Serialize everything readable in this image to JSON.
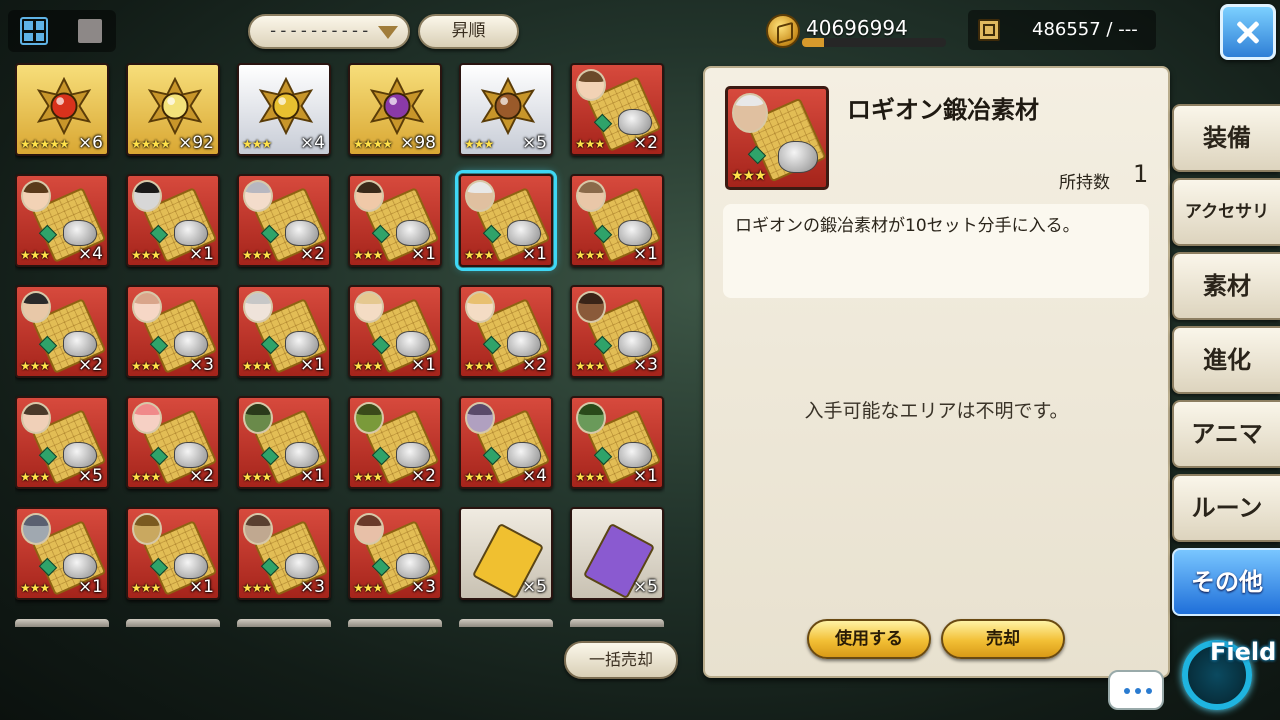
{
  "header": {
    "view_toggle": [
      "grid-view",
      "list-view"
    ],
    "filter_value": "----------",
    "sort_label": "昇順",
    "gold": "40696994",
    "gold_bar_fraction": 0.15,
    "materials": "486557 / ---"
  },
  "items": [
    {
      "type": "orb",
      "bg": "gold",
      "color": "#d9321c",
      "stars": "★★★★★",
      "qty": "×6"
    },
    {
      "type": "orb",
      "bg": "gold",
      "color": "#f3e27a",
      "stars": "★★★★",
      "qty": "×92"
    },
    {
      "type": "orb",
      "bg": "silver",
      "color": "#e8c030",
      "stars": "★★★",
      "qty": "×4"
    },
    {
      "type": "orb",
      "bg": "gold",
      "color": "#8a3aa8",
      "stars": "★★★★",
      "qty": "×98"
    },
    {
      "type": "orb",
      "bg": "silver",
      "color": "#9a5a2a",
      "stars": "★★★",
      "qty": "×5"
    },
    {
      "type": "scroll",
      "bg": "red",
      "face": "#f2d2b5",
      "hair": "#6b4a2a",
      "stars": "★★★",
      "qty": "×2"
    },
    {
      "type": "scroll",
      "bg": "red",
      "face": "#f2d2b5",
      "hair": "#5a3a1a",
      "stars": "★★★",
      "qty": "×4"
    },
    {
      "type": "scroll",
      "bg": "red",
      "face": "#d7d7d7",
      "hair": "#1a1a1a",
      "stars": "★★★",
      "qty": "×1"
    },
    {
      "type": "scroll",
      "bg": "red",
      "face": "#f3dccb",
      "hair": "#b7b7c0",
      "stars": "★★★",
      "qty": "×2"
    },
    {
      "type": "scroll",
      "bg": "red",
      "face": "#f0c9a8",
      "hair": "#3a2a1a",
      "stars": "★★★",
      "qty": "×1"
    },
    {
      "type": "scroll",
      "bg": "red",
      "face": "#e0c0a0",
      "hair": "#e8e8e8",
      "stars": "★★★",
      "qty": "×1",
      "selected": true
    },
    {
      "type": "scroll",
      "bg": "red",
      "face": "#e9c7a8",
      "hair": "#8a6a4a",
      "stars": "★★★",
      "qty": "×1"
    },
    {
      "type": "scroll",
      "bg": "red",
      "face": "#e8c8a8",
      "hair": "#2a2a2a",
      "stars": "★★★",
      "qty": "×2"
    },
    {
      "type": "scroll",
      "bg": "red",
      "face": "#f6d7c6",
      "hair": "#d9a58a",
      "stars": "★★★",
      "qty": "×3"
    },
    {
      "type": "scroll",
      "bg": "red",
      "face": "#efe3da",
      "hair": "#c7c7c7",
      "stars": "★★★",
      "qty": "×1"
    },
    {
      "type": "scroll",
      "bg": "red",
      "face": "#f4dcc4",
      "hair": "#e5c890",
      "stars": "★★★",
      "qty": "×1"
    },
    {
      "type": "scroll",
      "bg": "red",
      "face": "#f4dcc4",
      "hair": "#e8c070",
      "stars": "★★★",
      "qty": "×2"
    },
    {
      "type": "scroll",
      "bg": "red",
      "face": "#8a5a3a",
      "hair": "#3a2418",
      "stars": "★★★",
      "qty": "×3"
    },
    {
      "type": "scroll",
      "bg": "red",
      "face": "#f0d0b8",
      "hair": "#4a3a2a",
      "stars": "★★★",
      "qty": "×5"
    },
    {
      "type": "scroll",
      "bg": "red",
      "face": "#f6d0c4",
      "hair": "#f08a8a",
      "stars": "★★★",
      "qty": "×2"
    },
    {
      "type": "scroll",
      "bg": "red",
      "face": "#6a8a4a",
      "hair": "#2a3a1a",
      "stars": "★★★",
      "qty": "×1"
    },
    {
      "type": "scroll",
      "bg": "red",
      "face": "#7a9a3a",
      "hair": "#3a4a1a",
      "stars": "★★★",
      "qty": "×2"
    },
    {
      "type": "scroll",
      "bg": "red",
      "face": "#b0a0c0",
      "hair": "#5a4a6a",
      "stars": "★★★",
      "qty": "×4"
    },
    {
      "type": "scroll",
      "bg": "red",
      "face": "#6a9a5a",
      "hair": "#2a4a1a",
      "stars": "★★★",
      "qty": "×1"
    },
    {
      "type": "scroll",
      "bg": "red",
      "face": "#a0a8b0",
      "hair": "#5a6070",
      "stars": "★★★",
      "qty": "×1"
    },
    {
      "type": "scroll",
      "bg": "red",
      "face": "#c9a860",
      "hair": "#7a5a20",
      "stars": "★★★",
      "qty": "×1"
    },
    {
      "type": "scroll",
      "bg": "red",
      "face": "#c0a890",
      "hair": "#5a4030",
      "stars": "★★★",
      "qty": "×3"
    },
    {
      "type": "scroll",
      "bg": "red",
      "face": "#e8c0a8",
      "hair": "#6a3a2a",
      "stars": "★★★",
      "qty": "×3"
    },
    {
      "type": "ticket",
      "bg": "ticket",
      "color": "#f0c030",
      "stars": "",
      "qty": "×5"
    },
    {
      "type": "ticket",
      "bg": "ticket",
      "color": "#8a5ad0",
      "stars": "",
      "qty": "×5"
    }
  ],
  "bulk_sell_label": "一括売却",
  "detail": {
    "name": "ロギオン鍛冶素材",
    "stars": "★★★",
    "portrait_face": "#e0c0a0",
    "portrait_hair": "#e8e8e8",
    "owned_label": "所持数",
    "owned_value": "1",
    "description": "ロギオンの鍛冶素材が10セット分手に入る。",
    "area_text": "入手可能なエリアは不明です。",
    "use_label": "使用する",
    "sell_label": "売却"
  },
  "tabs": [
    {
      "label": "装備",
      "active": false
    },
    {
      "label": "アクセサリ",
      "active": false,
      "small": true
    },
    {
      "label": "素材",
      "active": false
    },
    {
      "label": "進化",
      "active": false
    },
    {
      "label": "アニマ",
      "active": false
    },
    {
      "label": "ルーン",
      "active": false
    },
    {
      "label": "その他",
      "active": true
    }
  ],
  "field_label": "Field"
}
